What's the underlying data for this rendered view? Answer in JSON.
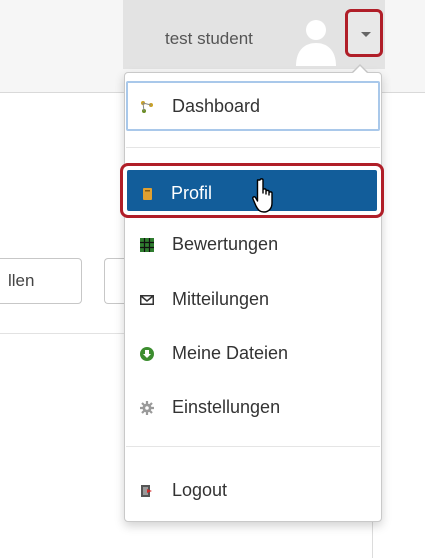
{
  "header": {
    "user_name": "test student",
    "avatar_icon": "user-silhouette-icon",
    "menu_toggle_icon": "caret-down-icon"
  },
  "background": {
    "button_label": "llen"
  },
  "menu": {
    "items": [
      {
        "label": "Dashboard",
        "icon": "dashboard-icon"
      },
      {
        "label": "Profil",
        "icon": "profile-icon",
        "active": true
      },
      {
        "label": "Bewertungen",
        "icon": "grades-icon"
      },
      {
        "label": "Mitteilungen",
        "icon": "envelope-icon"
      },
      {
        "label": "Meine Dateien",
        "icon": "download-icon"
      },
      {
        "label": "Einstellungen",
        "icon": "gear-icon"
      },
      {
        "label": "Logout",
        "icon": "logout-icon"
      }
    ]
  },
  "colors": {
    "highlight_border": "#b01e28",
    "active_item_bg": "#125d9a",
    "focus_border": "#a9c8ea"
  }
}
